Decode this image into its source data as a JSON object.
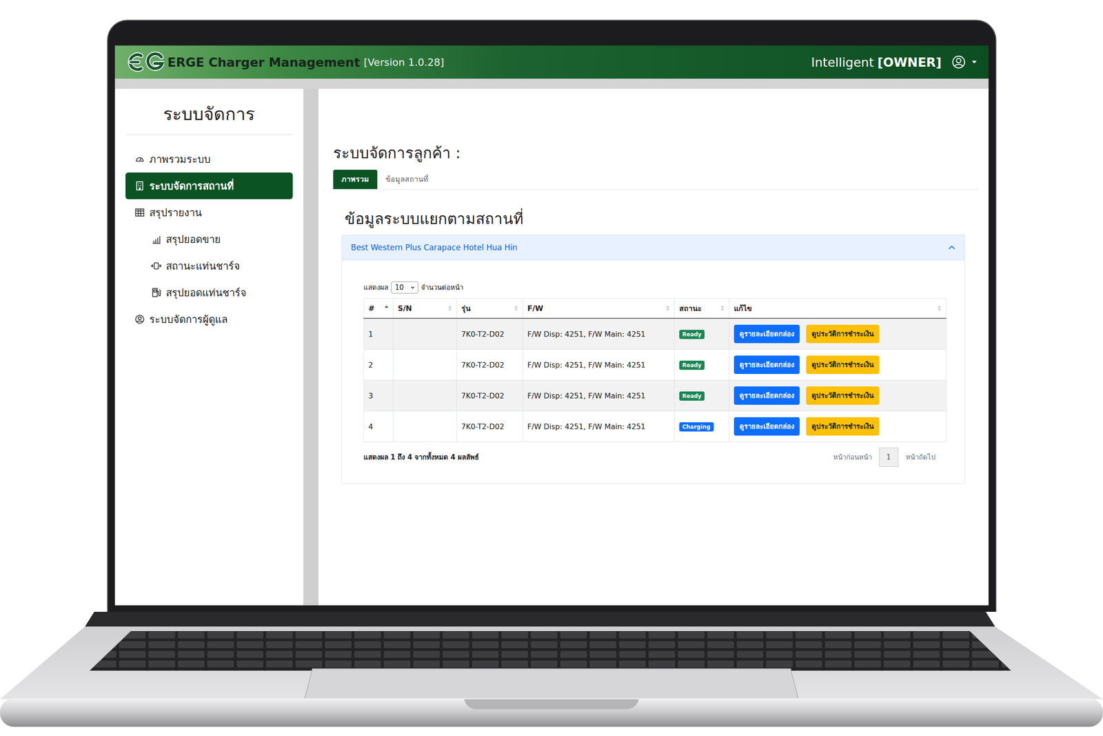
{
  "header": {
    "title": "ERGE Charger Management",
    "version": "[Version 1.0.28]",
    "user": "Intelligent",
    "role": "[OWNER]"
  },
  "sidebar": {
    "title": "ระบบจัดการ",
    "items": [
      {
        "label": "ภาพรวมระบบ",
        "selected": false
      },
      {
        "label": "ระบบจัดการสถานที่",
        "selected": true
      },
      {
        "label": "สรุปรายงาน",
        "selected": false,
        "children": [
          {
            "label": "สรุปยอดขาย",
            "selected": false
          },
          {
            "label": "สถานะแท่นชาร์จ",
            "selected": false
          },
          {
            "label": "สรุปยอดแท่นชาร์จ",
            "selected": false
          }
        ]
      },
      {
        "label": "ระบบจัดการผู้ดูแล",
        "selected": false
      }
    ]
  },
  "page": {
    "title": "ระบบจัดการลูกค้า :",
    "tabs": [
      {
        "label": "ภาพรวม",
        "selected": true
      },
      {
        "label": "ข้อมูลสถานที่",
        "selected": false
      }
    ],
    "section_title": "ข้อมูลระบบแยกตามสถานที่"
  },
  "site": {
    "name": "Best Western Plus Carapace Hotel Hua Hin",
    "expanded": true
  },
  "table": {
    "length_label": "แสดงผล",
    "length_value": "10",
    "length_suffix": "จำนวนต่อหน้า",
    "columns": [
      {
        "label": "#",
        "sorted": true
      },
      {
        "label": "S/N",
        "sorted": false
      },
      {
        "label": "รุ่น",
        "sorted": false
      },
      {
        "label": "F/W",
        "sorted": false
      },
      {
        "label": "สถานะ",
        "sorted": false
      },
      {
        "label": "แก้ไข",
        "sorted": false
      }
    ],
    "rows": [
      {
        "no": "1",
        "sn": "",
        "model": "7K0-T2-D02",
        "fw": "F/W Disp: 4251, F/W Main: 4251",
        "status": "Ready",
        "color": "#198754",
        "actions": [
          {
            "label": "ดูรายละเอียดกล่อง",
            "color": "#0d6efd"
          },
          {
            "label": "ดูประวัติการชำระเงิน",
            "color": "#ffc107"
          }
        ]
      },
      {
        "no": "2",
        "sn": "",
        "model": "7K0-T2-D02",
        "fw": "F/W Disp: 4251, F/W Main: 4251",
        "status": "Ready",
        "color": "#198754",
        "actions": [
          {
            "label": "ดูรายละเอียดกล่อง",
            "color": "#0d6efd"
          },
          {
            "label": "ดูประวัติการชำระเงิน",
            "color": "#ffc107"
          }
        ]
      },
      {
        "no": "3",
        "sn": "",
        "model": "7K0-T2-D02",
        "fw": "F/W Disp: 4251, F/W Main: 4251",
        "status": "Ready",
        "color": "#198754",
        "actions": [
          {
            "label": "ดูรายละเอียดกล่อง",
            "color": "#0d6efd"
          },
          {
            "label": "ดูประวัติการชำระเงิน",
            "color": "#ffc107"
          }
        ]
      },
      {
        "no": "4",
        "sn": "",
        "model": "7K0-T2-D02",
        "fw": "F/W Disp: 4251, F/W Main: 4251",
        "status": "Charging",
        "color": "#0d6efd",
        "actions": [
          {
            "label": "ดูรายละเอียดกล่อง",
            "color": "#0d6efd"
          },
          {
            "label": "ดูประวัติการชำระเงิน",
            "color": "#ffc107"
          }
        ]
      }
    ],
    "info": "แสดงผล 1 ถึง 4 จากทั้งหมด 4 ผลลัพธ์",
    "pagination": {
      "previous": {
        "label": "หน้าก่อนหน้า",
        "disabled": true
      },
      "pages": [
        {
          "label": "1",
          "selected": true
        }
      ],
      "next": {
        "label": "หน้าถัดไป",
        "disabled": true
      }
    }
  }
}
